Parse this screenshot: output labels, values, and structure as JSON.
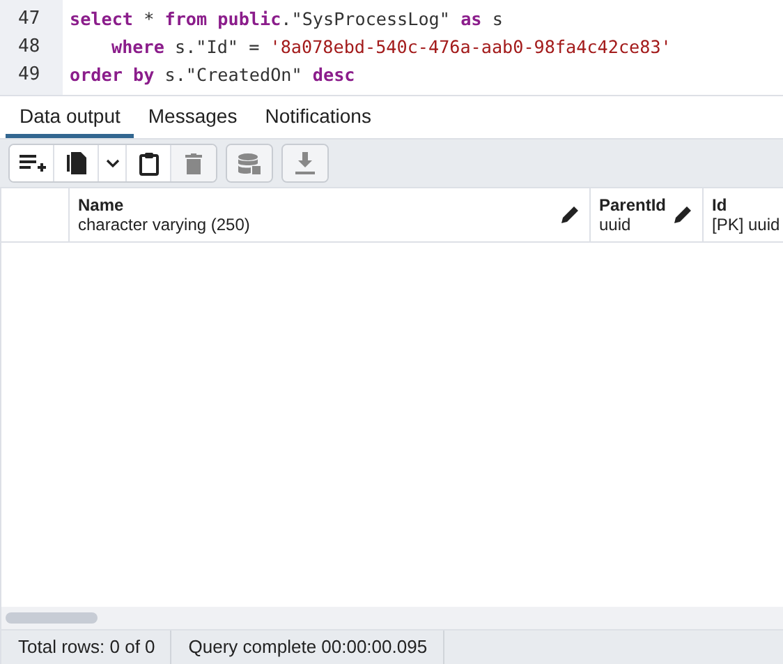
{
  "editor": {
    "lines": [
      {
        "number": "47",
        "indented": false,
        "tokens": [
          {
            "kind": "keyword",
            "text": "select"
          },
          {
            "kind": "plain",
            "text": " * "
          },
          {
            "kind": "keyword",
            "text": "from public"
          },
          {
            "kind": "plain",
            "text": ".\"SysProcessLog\" "
          },
          {
            "kind": "keyword",
            "text": "as"
          },
          {
            "kind": "plain",
            "text": " s"
          }
        ]
      },
      {
        "number": "48",
        "indented": true,
        "tokens": [
          {
            "kind": "keyword",
            "text": "where"
          },
          {
            "kind": "plain",
            "text": " s.\"Id\" = "
          },
          {
            "kind": "string",
            "text": "'8a078ebd-540c-476a-aab0-98fa4c42ce83'"
          }
        ]
      },
      {
        "number": "49",
        "indented": false,
        "tokens": [
          {
            "kind": "keyword",
            "text": "order by"
          },
          {
            "kind": "plain",
            "text": " s.\"CreatedOn\" "
          },
          {
            "kind": "keyword",
            "text": "desc"
          }
        ]
      }
    ]
  },
  "tabs": [
    {
      "label": "Data output",
      "selected": true
    },
    {
      "label": "Messages",
      "selected": false
    },
    {
      "label": "Notifications",
      "selected": false
    }
  ],
  "toolbar": [
    {
      "buttons": [
        {
          "kind": "add-row",
          "disabled": false
        },
        {
          "kind": "copy",
          "disabled": false
        },
        {
          "kind": "dropdown",
          "disabled": false
        },
        {
          "kind": "paste",
          "disabled": false
        },
        {
          "kind": "delete",
          "disabled": true
        }
      ]
    },
    {
      "buttons": [
        {
          "kind": "save",
          "disabled": true
        }
      ]
    },
    {
      "buttons": [
        {
          "kind": "download",
          "disabled": true
        }
      ]
    }
  ],
  "table": {
    "columns": [
      {
        "name": "Name",
        "type": "character varying (250)",
        "editable": true
      },
      {
        "name": "ParentId",
        "type": "uuid",
        "editable": true
      },
      {
        "name": "Id",
        "type": "[PK] uuid",
        "editable": false
      }
    ]
  },
  "status_bar": {
    "total_rows": "Total rows: 0 of 0",
    "query_status": "Query complete 00:00:00.095"
  }
}
